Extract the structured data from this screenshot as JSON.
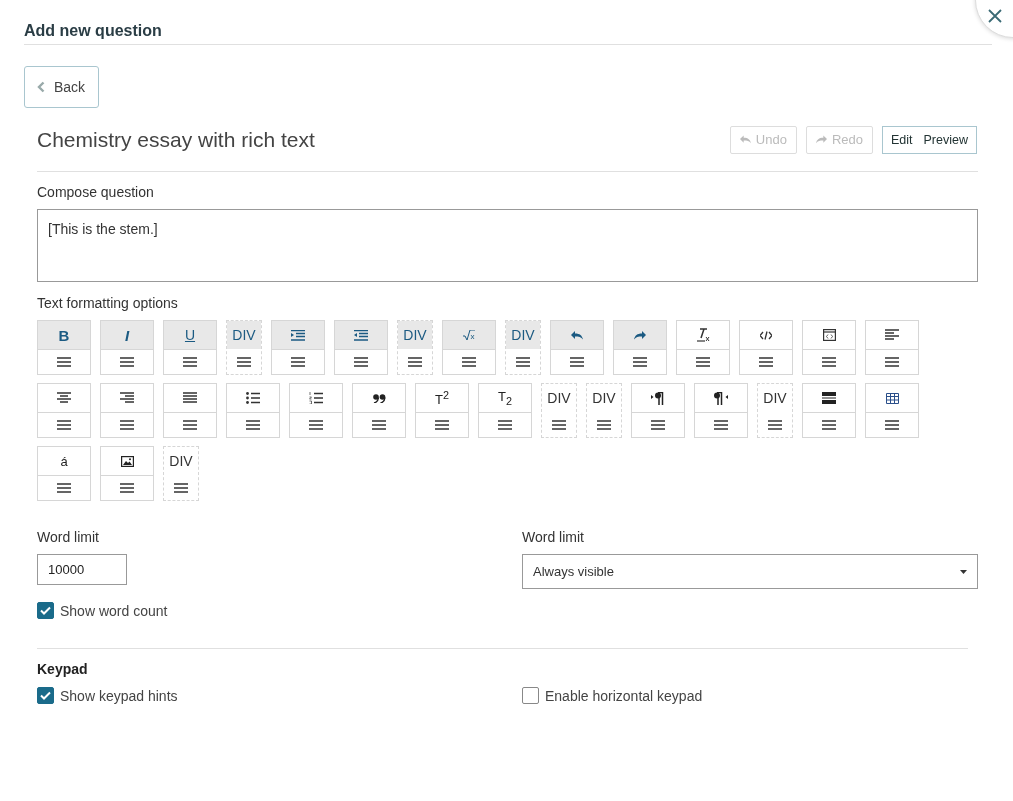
{
  "header": {
    "title": "Add new question"
  },
  "back_button": {
    "label": "Back"
  },
  "question_title": "Chemistry essay with rich text",
  "history_buttons": [
    {
      "kind": "undo",
      "label": "Undo",
      "disabled": true
    },
    {
      "kind": "redo",
      "label": "Redo",
      "disabled": true
    }
  ],
  "mode_toggle": [
    "Edit",
    "Preview"
  ],
  "compose": {
    "label": "Compose question",
    "value": "[This is the stem.]"
  },
  "formatting": {
    "label": "Text formatting options",
    "rows": [
      [
        {
          "kind": "bold",
          "label": "B",
          "active": true
        },
        {
          "kind": "italic",
          "label": "I",
          "active": true
        },
        {
          "kind": "underline",
          "label": "U",
          "active": true
        },
        {
          "kind": "div",
          "label": "DIV",
          "active": true
        },
        {
          "kind": "indent",
          "active": true
        },
        {
          "kind": "outdent",
          "active": true
        },
        {
          "kind": "div",
          "label": "DIV",
          "active": true
        },
        {
          "kind": "sqrt",
          "active": true
        },
        {
          "kind": "div",
          "label": "DIV",
          "active": true
        },
        {
          "kind": "undo",
          "active": true
        },
        {
          "kind": "redo",
          "active": true
        },
        {
          "kind": "clear-format",
          "active": false
        },
        {
          "kind": "code",
          "active": false
        },
        {
          "kind": "source",
          "active": false
        },
        {
          "kind": "align-left",
          "active": false
        }
      ],
      [
        {
          "kind": "align-center",
          "active": false
        },
        {
          "kind": "align-right",
          "active": false
        },
        {
          "kind": "justify",
          "active": false
        },
        {
          "kind": "bullets",
          "active": false
        },
        {
          "kind": "numbers",
          "active": false
        },
        {
          "kind": "quote",
          "active": false
        },
        {
          "kind": "superscript",
          "label": "T$^{2}$",
          "active": false
        },
        {
          "kind": "subscript",
          "label": "T$_{2}$",
          "active": false
        },
        {
          "kind": "div",
          "label": "DIV",
          "active": false
        },
        {
          "kind": "div",
          "label": "DIV",
          "active": false
        },
        {
          "kind": "ltr",
          "active": false
        },
        {
          "kind": "rtl",
          "active": false
        },
        {
          "kind": "div",
          "label": "DIV",
          "active": false
        },
        {
          "kind": "hrule",
          "active": false
        },
        {
          "kind": "table",
          "active": false
        }
      ],
      [
        {
          "kind": "character",
          "label": "á",
          "active": false
        },
        {
          "kind": "image",
          "active": false
        },
        {
          "kind": "div",
          "label": "DIV",
          "active": false
        }
      ]
    ]
  },
  "word_limit": {
    "label": "Word limit",
    "value": "10000"
  },
  "word_limit_mode": {
    "label": "Word limit",
    "value": "Always visible"
  },
  "show_word_count": {
    "label": "Show word count",
    "checked": true
  },
  "keypad": {
    "title": "Keypad",
    "options": [
      {
        "label": "Show keypad hints",
        "checked": true
      },
      {
        "label": "Enable horizontal keypad",
        "checked": false
      }
    ]
  }
}
